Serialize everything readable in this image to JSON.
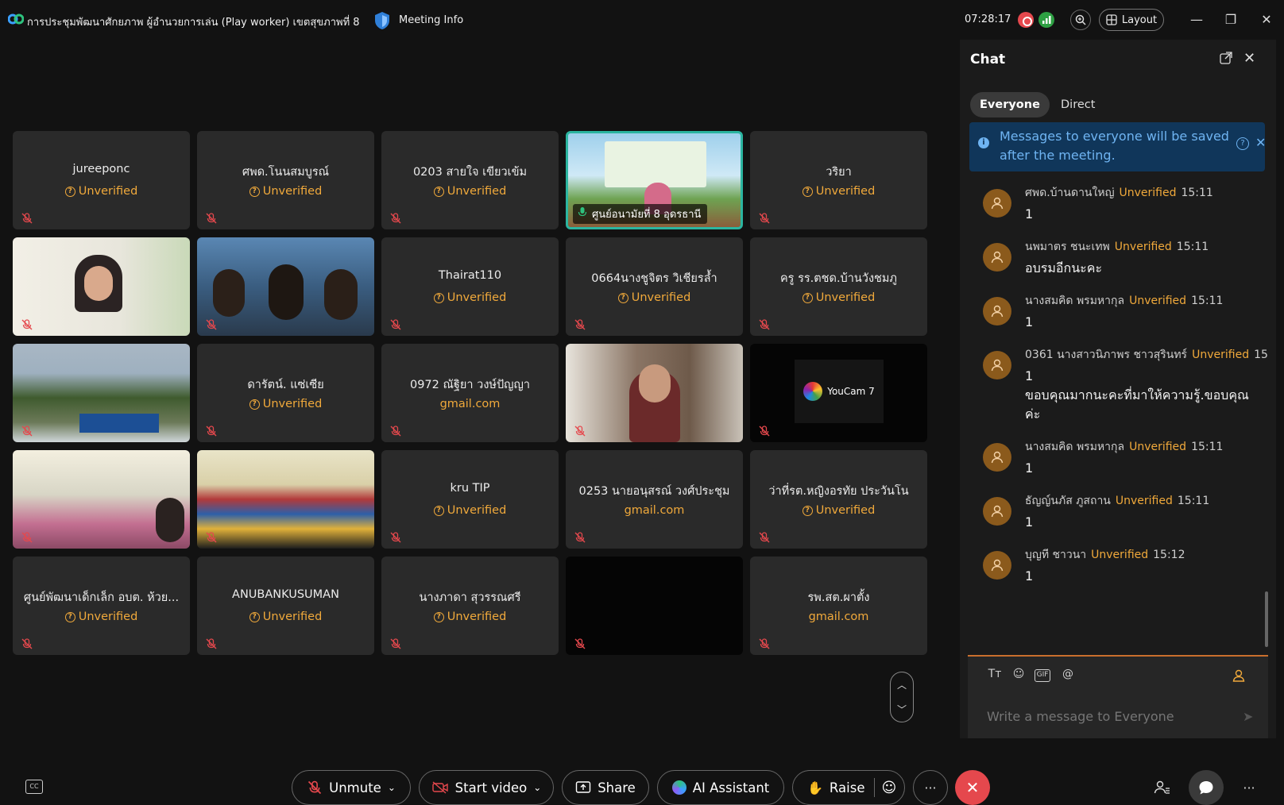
{
  "window": {
    "meeting_title": "การประชุมพัฒนาศักยภาพ ผู้อำนวยการเล่น (Play worker) เขตสุขภาพที่ 8",
    "meeting_info_label": "Meeting Info",
    "clock": "07:28:17",
    "layout_label": "Layout"
  },
  "colors": {
    "unverified": "#f0a93b",
    "active_speaker": "#2bb5a0",
    "end_call": "#e5484d",
    "notice_bg": "#10365a"
  },
  "tiles": [
    {
      "name": "jureeponc",
      "status": "Unverified"
    },
    {
      "name": "ศพด.โนนสมบูรณ์",
      "status": "Unverified"
    },
    {
      "name": "0203 สายใจ  เขียวเข้ม",
      "status": "Unverified"
    },
    {
      "chip": "ศูนย์อนามัยที่ 8 อุดรธานี"
    },
    {
      "name": "วริยา",
      "status": "Unverified"
    },
    {
      "name": "",
      "status": ""
    },
    {
      "name": "",
      "status": ""
    },
    {
      "name": "Thairat110",
      "status": "Unverified"
    },
    {
      "name": "0664นางชูจิตร วิเชียรล้ำ",
      "status": "Unverified"
    },
    {
      "name": "ครู รร.ตชด.บ้านวังชมภู",
      "status": "Unverified"
    },
    {
      "name": "",
      "status": ""
    },
    {
      "name": "ดารัตน์. แซ่เซีย",
      "status": "Unverified"
    },
    {
      "name": "0972 ณัฐิยา วงษ์ปัญญา",
      "status": "gmail.com"
    },
    {
      "name": "",
      "status": ""
    },
    {
      "logo": "YouCam 7"
    },
    {
      "name": "",
      "status": ""
    },
    {
      "name": "",
      "status": ""
    },
    {
      "name": "kru TIP",
      "status": "Unverified"
    },
    {
      "name": "0253 นายอนุสรณ์ วงศ์ประชุม",
      "status": "gmail.com"
    },
    {
      "name": "ว่าที่รต.หญิงอรทัย ประวันโน",
      "status": "Unverified"
    },
    {
      "name": "ศูนย์พัฒนาเด็กเล็ก อบต. ห้วย...",
      "status": "Unverified"
    },
    {
      "name": "ANUBANKUSUMAN",
      "status": "Unverified"
    },
    {
      "name": "นางภาดา  สุวรรณศรี",
      "status": "Unverified"
    },
    {
      "name": "",
      "status": ""
    },
    {
      "name": "รพ.สต.ผาตั้ง",
      "status": "gmail.com"
    }
  ],
  "chat": {
    "title": "Chat",
    "tabs": {
      "everyone": "Everyone",
      "direct": "Direct"
    },
    "notice": "Messages to everyone will be saved after the meeting.",
    "messages": [
      {
        "sender": "ศพด.บ้านดานใหญ่",
        "badge": "Unverified",
        "time": "15:11",
        "text": "1"
      },
      {
        "sender": "นพมาตร ชนะเทพ",
        "badge": "Unverified",
        "time": "15:11",
        "text": "อบรมอีกนะคะ"
      },
      {
        "sender": "นางสมคิด พรมหากุล",
        "badge": "Unverified",
        "time": "15:11",
        "text": "1"
      },
      {
        "sender": "0361 นางสาวนิภาพร ชาวสุรินทร์",
        "badge": "Unverified",
        "time": "15",
        "text": "1\nขอบคุณมากนะคะที่มาให้ความรู้.ขอบคุณค่ะ"
      },
      {
        "sender": "นางสมคิด พรมหากุล",
        "badge": "Unverified",
        "time": "15:11",
        "text": "1"
      },
      {
        "sender": "ธัญญ์นภัส ภูสถาน",
        "badge": "Unverified",
        "time": "15:11",
        "text": "1"
      },
      {
        "sender": "บุญที ชาวนา",
        "badge": "Unverified",
        "time": "15:12",
        "text": "1"
      }
    ],
    "composer_placeholder": "Write a message to Everyone"
  },
  "toolbar": {
    "unmute": "Unmute",
    "start_video": "Start video",
    "share": "Share",
    "ai_assistant": "AI Assistant",
    "raise": "Raise"
  }
}
